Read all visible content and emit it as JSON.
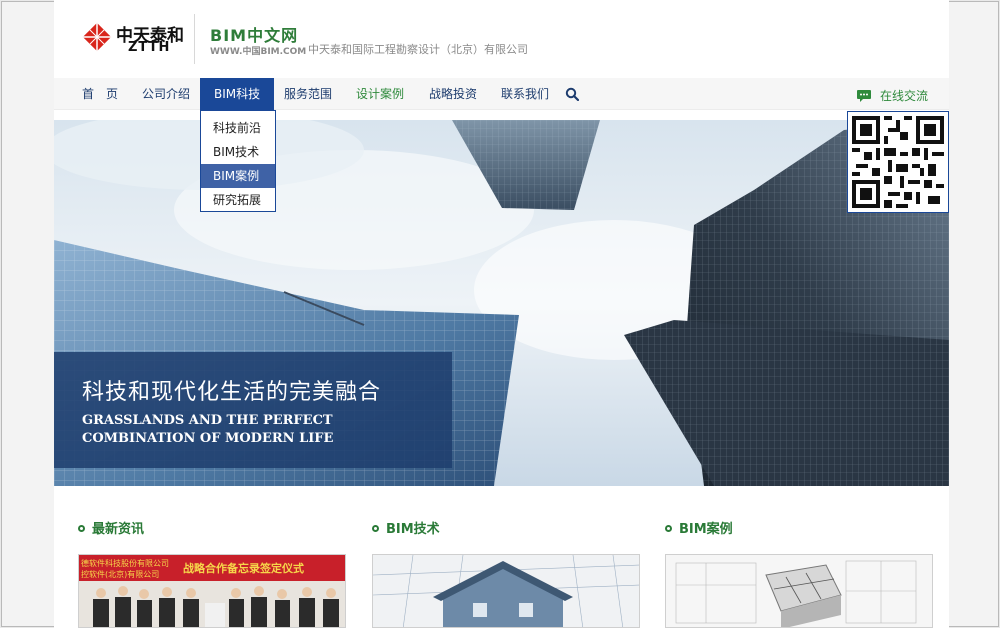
{
  "header": {
    "logo_cn": "中天泰和",
    "logo_en": "ZTTH",
    "site_name": "BIM中文网",
    "site_url": "WWW.中国BIM.COM",
    "company": "中天泰和国际工程勘察设计（北京）有限公司"
  },
  "nav": {
    "items": [
      {
        "label": "首　页"
      },
      {
        "label": "公司介绍"
      },
      {
        "label": "BIM科技"
      },
      {
        "label": "服务范围"
      },
      {
        "label": "设计案例"
      },
      {
        "label": "战略投资"
      },
      {
        "label": "联系我们"
      }
    ],
    "active_index": 2,
    "chat_label": "在线交流"
  },
  "dropdown": {
    "items": [
      {
        "label": "科技前沿"
      },
      {
        "label": "BIM技术"
      },
      {
        "label": "BIM案例"
      },
      {
        "label": "研究拓展"
      }
    ],
    "highlighted_index": 2
  },
  "banner": {
    "title_cn": "科技和现代化生活的完美融合",
    "title_en": "GRASSLANDS AND THE PERFECT COMBINATION OF MODERN LIFE"
  },
  "sections": [
    {
      "title": "最新资讯",
      "thumb_caption": "战略合作备忘录签定仪式",
      "thumb_banner_left": "德软件科技股份有限公司\n控软件(北京)有限公司"
    },
    {
      "title": "BIM技术"
    },
    {
      "title": "BIM案例"
    }
  ],
  "colors": {
    "brand_blue": "#1a4898",
    "green": "#2f7d3a",
    "logo_red": "#d9261c"
  }
}
